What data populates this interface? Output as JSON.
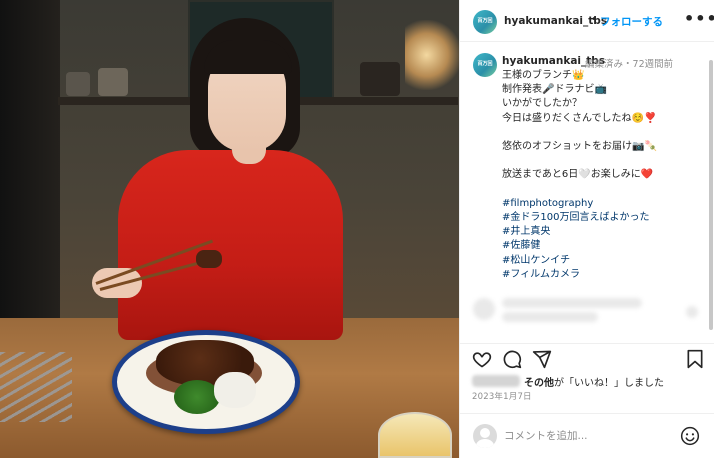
{
  "post": {
    "username": "hyakumankai_tbs",
    "follow_label": "フォローする",
    "more_label": "•••",
    "avatar_text": "百万回",
    "caption_edited": "編集済み",
    "caption_dot": "・",
    "caption_age": "72週間前",
    "caption_lines": [
      "王様のブランチ👑",
      "制作発表🎤ドラナビ📺",
      "いかがでしたか？",
      "今日は盛りだくさんでしたね☺️❣️",
      "",
      "悠依のオフショットをお届け📷🍡",
      "",
      "放送まであと6日🤍お楽しみに❤️"
    ],
    "hashtags": [
      "#filmphotography",
      "#金ドラ100万回言えばよかった",
      "#井上真央",
      "#佐藤健",
      "#松山ケンイチ",
      "#フィルムカメラ"
    ],
    "likes_text_bold": "その他",
    "likes_text_rest": "が「いいね！」しました",
    "date": "2023年1月7日",
    "comment_placeholder": "コメントを追加...",
    "colors": {
      "follow": "#0095f6",
      "muted": "#8e8e8e",
      "hashtag": "#00376b"
    },
    "icons": [
      "heart-icon",
      "comment-icon",
      "share-icon",
      "bookmark-icon",
      "emoji-icon"
    ]
  }
}
